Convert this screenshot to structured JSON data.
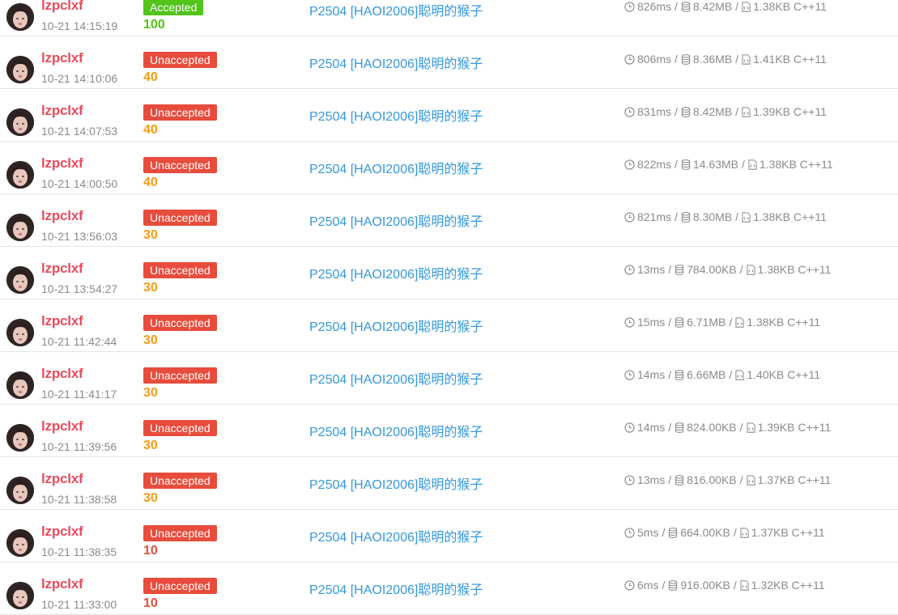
{
  "colors": {
    "username": "#e74c5d",
    "unaccepted": "#e74c3c",
    "accepted": "#52c41a",
    "score_mid": "#f39c11",
    "score_low": "#e74c3c",
    "problem_link": "#3498db",
    "muted": "#8b8b8b"
  },
  "separator": "/",
  "records": [
    {
      "user": "lzpclxf",
      "time": "10-21 14:15:19",
      "status": "Accepted",
      "score": "100",
      "problem": "P2504 [HAOI2006]聪明的猴子",
      "runtime": "826ms",
      "memory": "8.42MB",
      "code": "1.38KB C++11"
    },
    {
      "user": "lzpclxf",
      "time": "10-21 14:10:06",
      "status": "Unaccepted",
      "score": "40",
      "problem": "P2504 [HAOI2006]聪明的猴子",
      "runtime": "806ms",
      "memory": "8.36MB",
      "code": "1.41KB C++11"
    },
    {
      "user": "lzpclxf",
      "time": "10-21 14:07:53",
      "status": "Unaccepted",
      "score": "40",
      "problem": "P2504 [HAOI2006]聪明的猴子",
      "runtime": "831ms",
      "memory": "8.42MB",
      "code": "1.39KB C++11"
    },
    {
      "user": "lzpclxf",
      "time": "10-21 14:00:50",
      "status": "Unaccepted",
      "score": "40",
      "problem": "P2504 [HAOI2006]聪明的猴子",
      "runtime": "822ms",
      "memory": "14.63MB",
      "code": "1.38KB C++11"
    },
    {
      "user": "lzpclxf",
      "time": "10-21 13:56:03",
      "status": "Unaccepted",
      "score": "30",
      "problem": "P2504 [HAOI2006]聪明的猴子",
      "runtime": "821ms",
      "memory": "8.30MB",
      "code": "1.38KB C++11"
    },
    {
      "user": "lzpclxf",
      "time": "10-21 13:54:27",
      "status": "Unaccepted",
      "score": "30",
      "problem": "P2504 [HAOI2006]聪明的猴子",
      "runtime": "13ms",
      "memory": "784.00KB",
      "code": "1.38KB C++11"
    },
    {
      "user": "lzpclxf",
      "time": "10-21 11:42:44",
      "status": "Unaccepted",
      "score": "30",
      "problem": "P2504 [HAOI2006]聪明的猴子",
      "runtime": "15ms",
      "memory": "6.71MB",
      "code": "1.38KB C++11"
    },
    {
      "user": "lzpclxf",
      "time": "10-21 11:41:17",
      "status": "Unaccepted",
      "score": "30",
      "problem": "P2504 [HAOI2006]聪明的猴子",
      "runtime": "14ms",
      "memory": "6.66MB",
      "code": "1.40KB C++11"
    },
    {
      "user": "lzpclxf",
      "time": "10-21 11:39:56",
      "status": "Unaccepted",
      "score": "30",
      "problem": "P2504 [HAOI2006]聪明的猴子",
      "runtime": "14ms",
      "memory": "824.00KB",
      "code": "1.39KB C++11"
    },
    {
      "user": "lzpclxf",
      "time": "10-21 11:38:58",
      "status": "Unaccepted",
      "score": "30",
      "problem": "P2504 [HAOI2006]聪明的猴子",
      "runtime": "13ms",
      "memory": "816.00KB",
      "code": "1.37KB C++11"
    },
    {
      "user": "lzpclxf",
      "time": "10-21 11:38:35",
      "status": "Unaccepted",
      "score": "10",
      "problem": "P2504 [HAOI2006]聪明的猴子",
      "runtime": "5ms",
      "memory": "664.00KB",
      "code": "1.37KB C++11"
    },
    {
      "user": "lzpclxf",
      "time": "10-21 11:33:00",
      "status": "Unaccepted",
      "score": "10",
      "problem": "P2504 [HAOI2006]聪明的猴子",
      "runtime": "6ms",
      "memory": "916.00KB",
      "code": "1.32KB C++11"
    }
  ]
}
